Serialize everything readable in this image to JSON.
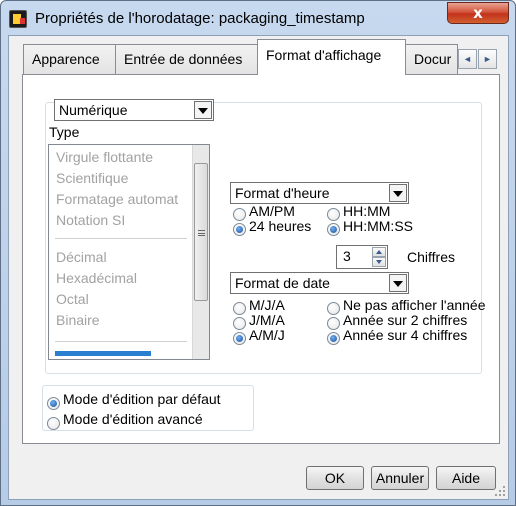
{
  "window": {
    "title": "Propriétés de l'horodatage: packaging_timestamp",
    "close_glyph": "x"
  },
  "tabs": [
    {
      "label": "Apparence",
      "active": false
    },
    {
      "label": "Entrée de données",
      "active": false
    },
    {
      "label": "Format d'affichage",
      "active": true
    },
    {
      "label": "Docur",
      "active": false
    }
  ],
  "tab_scroll": {
    "left_glyph": "◄",
    "right_glyph": "►"
  },
  "format": {
    "category_select": "Numérique",
    "type_label": "Type",
    "type_list": {
      "group1": [
        "Virgule flottante",
        "Scientifique",
        "Formatage automat",
        "Notation SI"
      ],
      "group2": [
        "Décimal",
        "Hexadécimal",
        "Octal",
        "Binaire"
      ]
    }
  },
  "time": {
    "select": "Format d'heure",
    "options": {
      "ampm": {
        "label": "AM/PM",
        "selected": false
      },
      "h24": {
        "label": "24 heures",
        "selected": true
      },
      "hhmm": {
        "label": "HH:MM",
        "selected": false
      },
      "hhmmss": {
        "label": "HH:MM:SS",
        "selected": true
      }
    },
    "digits_value": "3",
    "digits_label": "Chiffres"
  },
  "date": {
    "select": "Format de date",
    "options": {
      "mja": {
        "label": "M/J/A",
        "selected": false
      },
      "jma": {
        "label": "J/M/A",
        "selected": false
      },
      "amj": {
        "label": "A/M/J",
        "selected": true
      },
      "no_year": {
        "label": "Ne pas afficher l'année",
        "selected": false
      },
      "year2": {
        "label": "Année sur 2 chiffres",
        "selected": false
      },
      "year4": {
        "label": "Année sur 4 chiffres",
        "selected": true
      }
    }
  },
  "edit_mode": {
    "default": {
      "label": "Mode d'édition par défaut",
      "selected": true
    },
    "advanced": {
      "label": "Mode d'édition avancé",
      "selected": false
    }
  },
  "buttons": {
    "ok": "OK",
    "cancel": "Annuler",
    "help": "Aide"
  }
}
